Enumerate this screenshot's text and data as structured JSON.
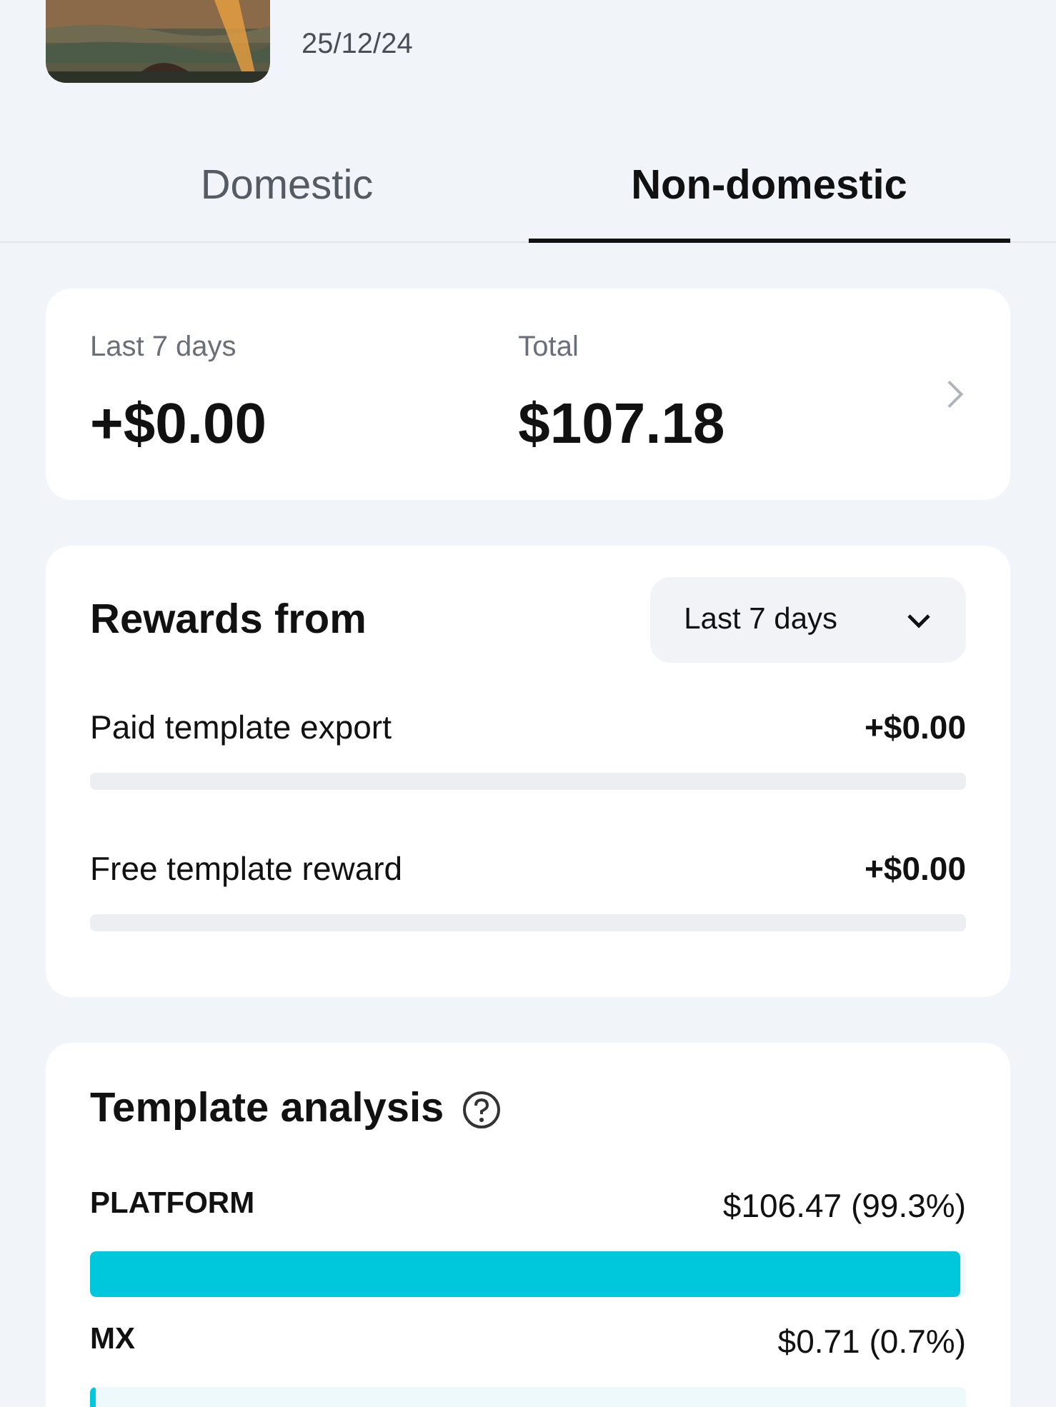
{
  "header": {
    "date": "25/12/24"
  },
  "tabs": [
    {
      "label": "Domestic",
      "selected": false
    },
    {
      "label": "Non-domestic",
      "selected": true
    }
  ],
  "summary": {
    "items": [
      {
        "label": "Last 7 days",
        "value": "+$0.00"
      },
      {
        "label": "Total",
        "value": "$107.18"
      }
    ]
  },
  "rewards": {
    "title": "Rewards from",
    "period": "Last 7 days",
    "rows": [
      {
        "name": "Paid template export",
        "amount": "+$0.00",
        "level": 0
      },
      {
        "name": "Free template reward",
        "amount": "+$0.00",
        "level": 0
      }
    ]
  },
  "analysis": {
    "title": "Template analysis",
    "rows": [
      {
        "name": "PLATFORM",
        "amount": "$106.47 (99.3%)",
        "level": 0.993
      },
      {
        "name": "MX",
        "amount": "$0.71 (0.7%)",
        "level": 0.007
      }
    ]
  }
}
